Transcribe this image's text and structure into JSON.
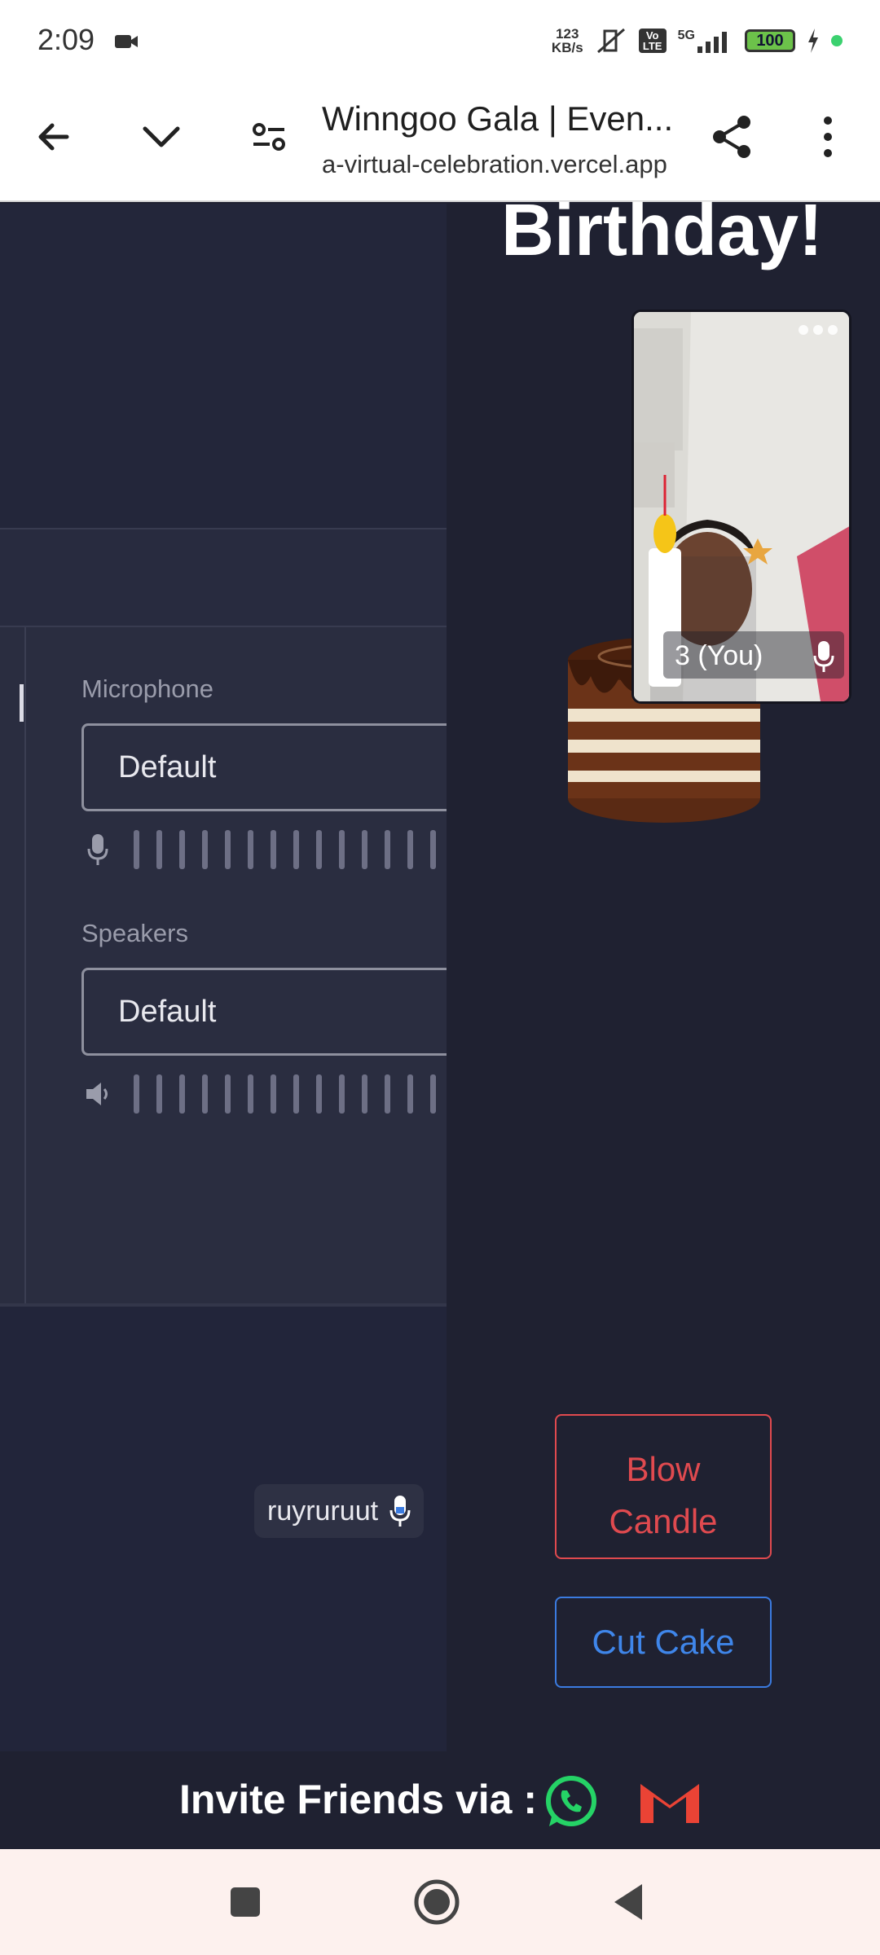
{
  "status_bar": {
    "time": "2:09",
    "net_speed_value": "123",
    "net_speed_unit": "KB/s",
    "network": "5G",
    "volte": "Vo LTE",
    "battery": "100"
  },
  "browser": {
    "tab_title": "Winngoo Gala | Even...",
    "url": "a-virtual-celebration.vercel.app"
  },
  "settings": {
    "microphone_label": "Microphone",
    "microphone_value": "Default",
    "speakers_label": "Speakers",
    "speakers_value": "Default"
  },
  "event": {
    "title": "Birthday!",
    "video_name": "3  (You)",
    "blow_candle_line1": "Blow",
    "blow_candle_line2": "Candle",
    "cut_cake_label": "Cut Cake",
    "user_chip": "ruyruruut"
  },
  "invite": {
    "label": "Invite Friends via :"
  },
  "colors": {
    "background": "#1f2131",
    "blow_candle": "#e04a4f",
    "cut_cake": "#3f86ea",
    "whatsapp": "#25d366",
    "gmail": "#ea4335"
  },
  "icons": [
    "back-arrow-icon",
    "chevron-down-icon",
    "site-settings-icon",
    "share-icon",
    "more-vert-icon",
    "mic-icon",
    "speaker-icon",
    "whatsapp-icon",
    "gmail-icon",
    "nav-recents-icon",
    "nav-home-icon",
    "nav-back-icon"
  ]
}
